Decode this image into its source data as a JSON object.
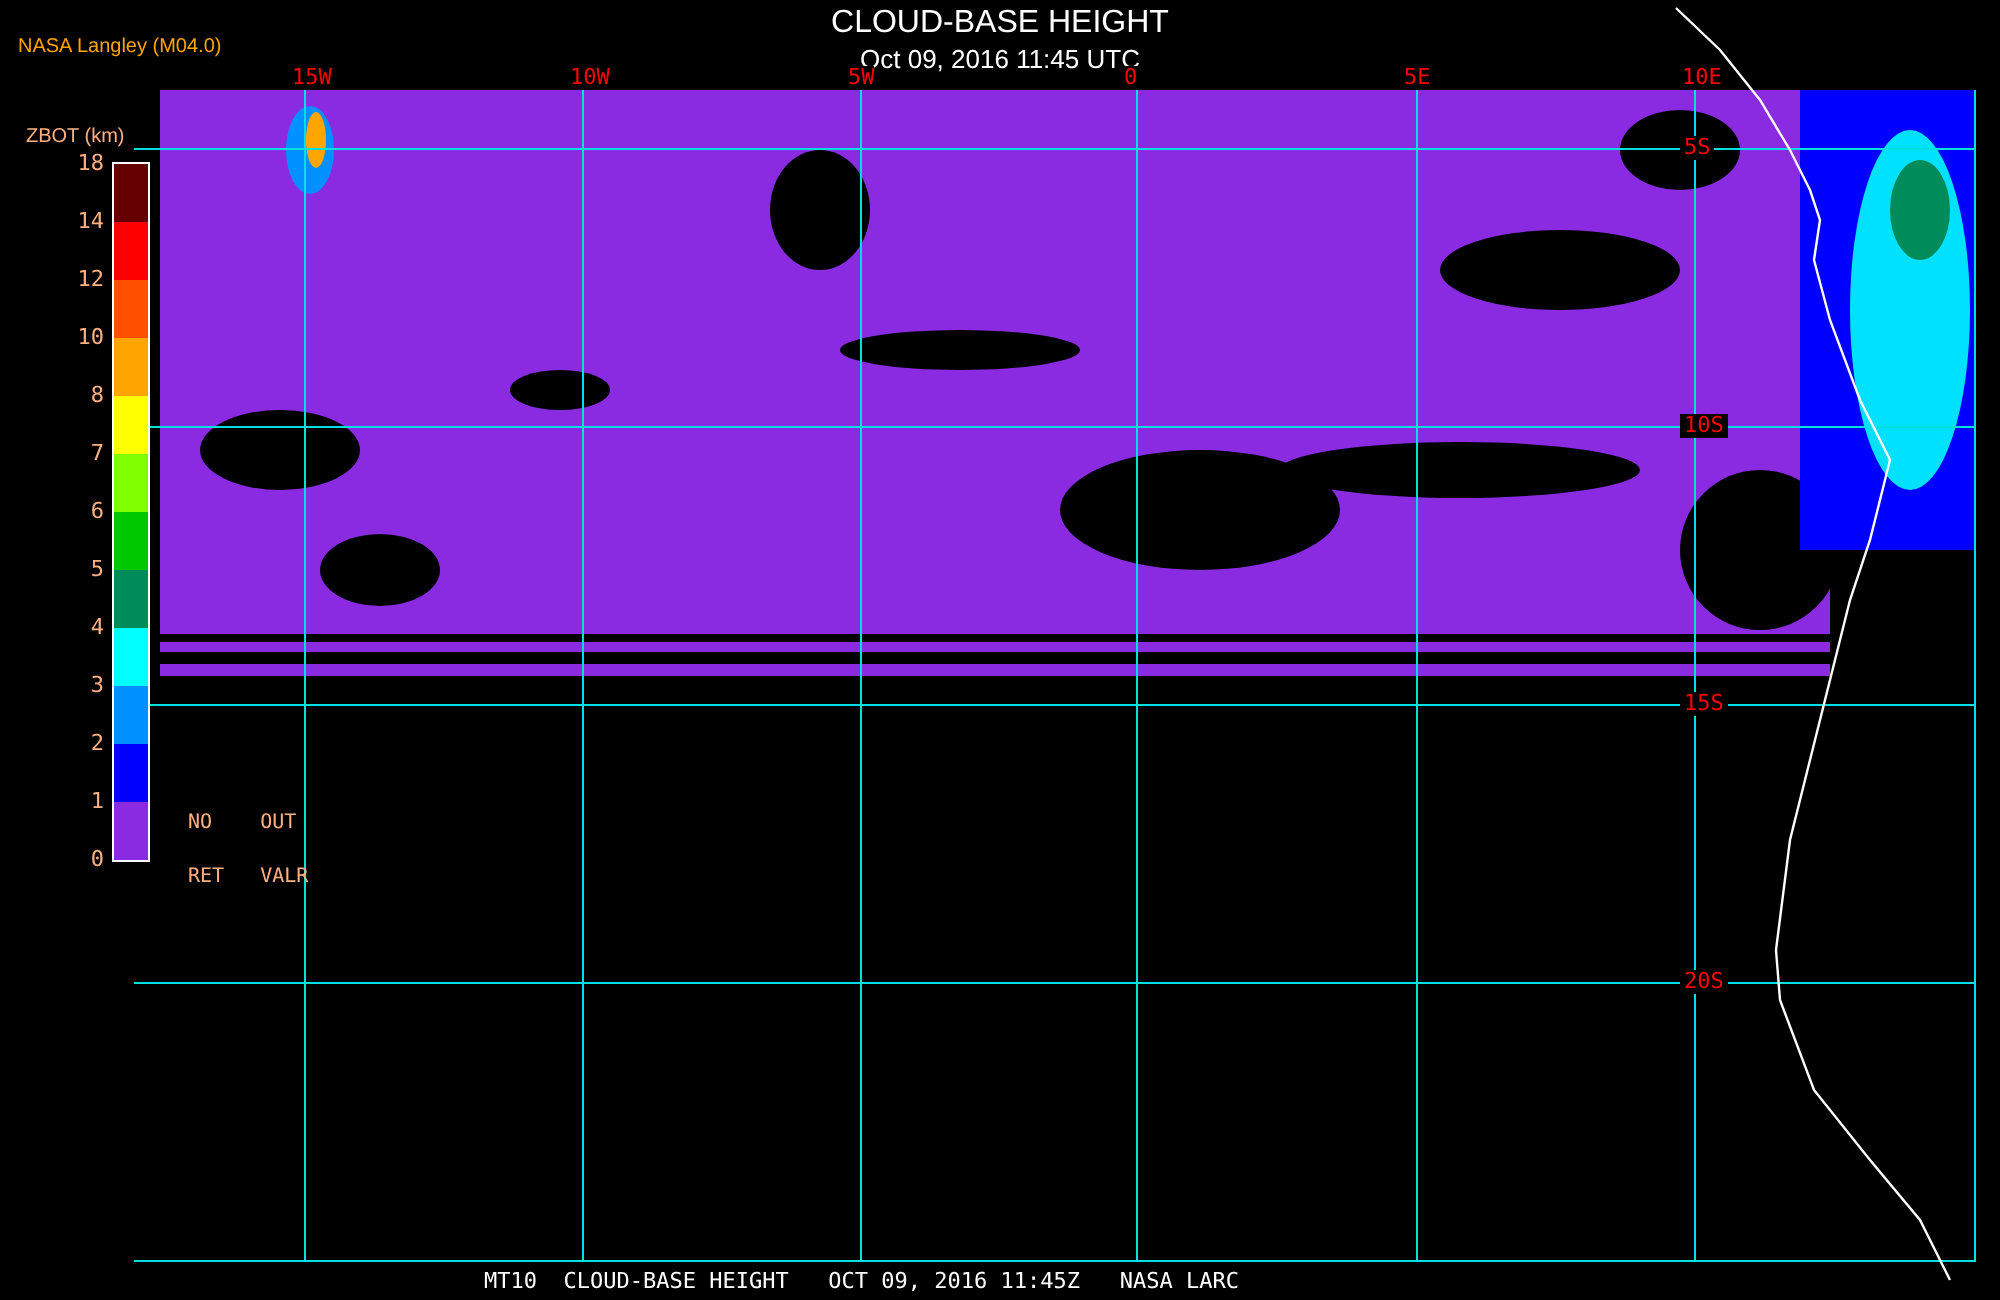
{
  "header": {
    "title": "CLOUD-BASE HEIGHT",
    "subtitle": "Oct 09, 2016 11:45 UTC",
    "producer": "NASA Langley (M04.0)"
  },
  "legend": {
    "title": "ZBOT (km)",
    "ticks": [
      "18",
      "14",
      "12",
      "10",
      "8",
      "7",
      "6",
      "5",
      "4",
      "3",
      "2",
      "1",
      "0"
    ],
    "bins": [
      {
        "color": "#660000"
      },
      {
        "color": "#ff0000"
      },
      {
        "color": "#ff5000"
      },
      {
        "color": "#ffa500"
      },
      {
        "color": "#ffff00"
      },
      {
        "color": "#80ff00"
      },
      {
        "color": "#00c800"
      },
      {
        "color": "#008c5a"
      },
      {
        "color": "#00ffff"
      },
      {
        "color": "#0090ff"
      },
      {
        "color": "#0000ff"
      },
      {
        "color": "#8a2be2"
      }
    ],
    "notes": [
      "NO",
      "OUT",
      "RET",
      "VALR"
    ]
  },
  "map": {
    "lon_labels": [
      "15W",
      "10W",
      "5W",
      "0",
      "5E",
      "10E"
    ],
    "lat_labels": [
      "5S",
      "10S",
      "15S",
      "20S"
    ]
  },
  "footer": "MT10  CLOUD-BASE HEIGHT   OCT 09, 2016 11:45Z   NASA LARC"
}
